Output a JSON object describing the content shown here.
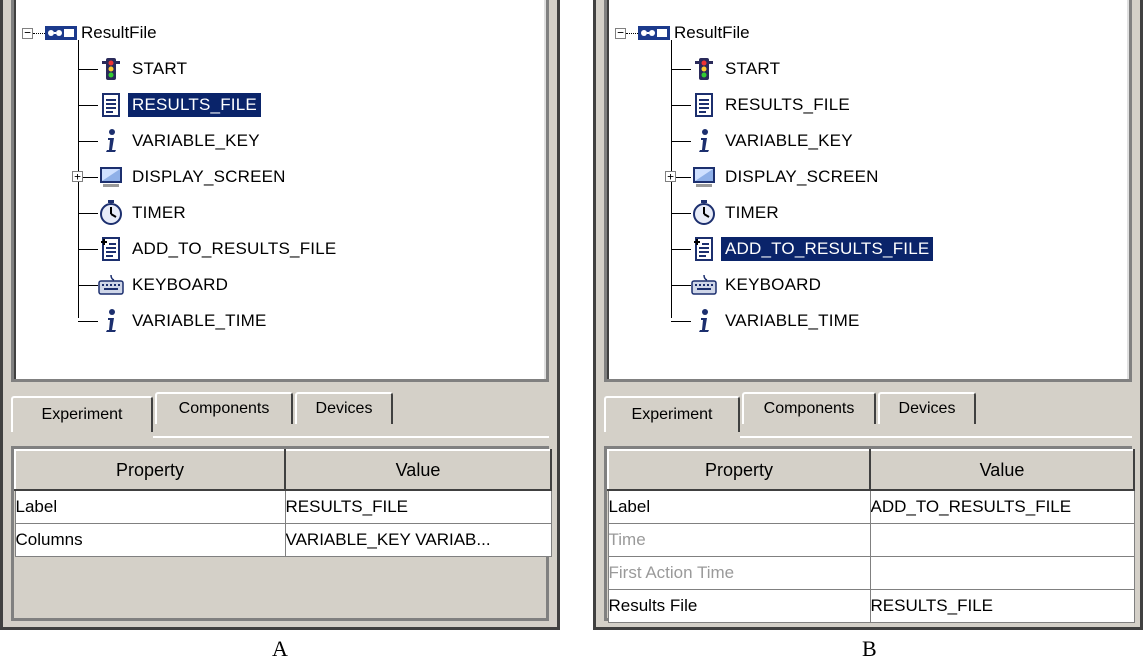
{
  "panels": [
    {
      "tree": {
        "root": "ResultFile",
        "nodes": [
          {
            "label": "START",
            "icon": "traffic-light-icon",
            "selected": false
          },
          {
            "label": "RESULTS_FILE",
            "icon": "document-icon",
            "selected": true
          },
          {
            "label": "VARIABLE_KEY",
            "icon": "info-icon",
            "selected": false
          },
          {
            "label": "DISPLAY_SCREEN",
            "icon": "monitor-icon",
            "selected": false,
            "expandable": true
          },
          {
            "label": "TIMER",
            "icon": "stopwatch-icon",
            "selected": false
          },
          {
            "label": "ADD_TO_RESULTS_FILE",
            "icon": "document-add-icon",
            "selected": false
          },
          {
            "label": "KEYBOARD",
            "icon": "keyboard-icon",
            "selected": false
          },
          {
            "label": "VARIABLE_TIME",
            "icon": "info-icon",
            "selected": false
          }
        ]
      },
      "tabs": [
        "Experiment",
        "Components",
        "Devices"
      ],
      "active_tab": "Experiment",
      "properties": {
        "headers": [
          "Property",
          "Value"
        ],
        "rows": [
          {
            "property": "Label",
            "value": "RESULTS_FILE",
            "dim": false
          },
          {
            "property": "Columns",
            "value": "VARIABLE_KEY VARIAB...",
            "dim": false
          }
        ]
      },
      "caption": "A"
    },
    {
      "tree": {
        "root": "ResultFile",
        "nodes": [
          {
            "label": "START",
            "icon": "traffic-light-icon",
            "selected": false
          },
          {
            "label": "RESULTS_FILE",
            "icon": "document-icon",
            "selected": false
          },
          {
            "label": "VARIABLE_KEY",
            "icon": "info-icon",
            "selected": false
          },
          {
            "label": "DISPLAY_SCREEN",
            "icon": "monitor-icon",
            "selected": false,
            "expandable": true
          },
          {
            "label": "TIMER",
            "icon": "stopwatch-icon",
            "selected": false
          },
          {
            "label": "ADD_TO_RESULTS_FILE",
            "icon": "document-add-icon",
            "selected": true
          },
          {
            "label": "KEYBOARD",
            "icon": "keyboard-icon",
            "selected": false
          },
          {
            "label": "VARIABLE_TIME",
            "icon": "info-icon",
            "selected": false
          }
        ]
      },
      "tabs": [
        "Experiment",
        "Components",
        "Devices"
      ],
      "active_tab": "Experiment",
      "properties": {
        "headers": [
          "Property",
          "Value"
        ],
        "rows": [
          {
            "property": "Label",
            "value": "ADD_TO_RESULTS_FILE",
            "dim": false
          },
          {
            "property": "Time",
            "value": "",
            "dim": true
          },
          {
            "property": "First Action Time",
            "value": "",
            "dim": true
          },
          {
            "property": "Results File",
            "value": "RESULTS_FILE",
            "dim": false
          }
        ]
      },
      "caption": "B"
    }
  ],
  "colors": {
    "selection": "#0a246a",
    "panel": "#d4d0c8",
    "dim_text": "#9a9a9a"
  }
}
